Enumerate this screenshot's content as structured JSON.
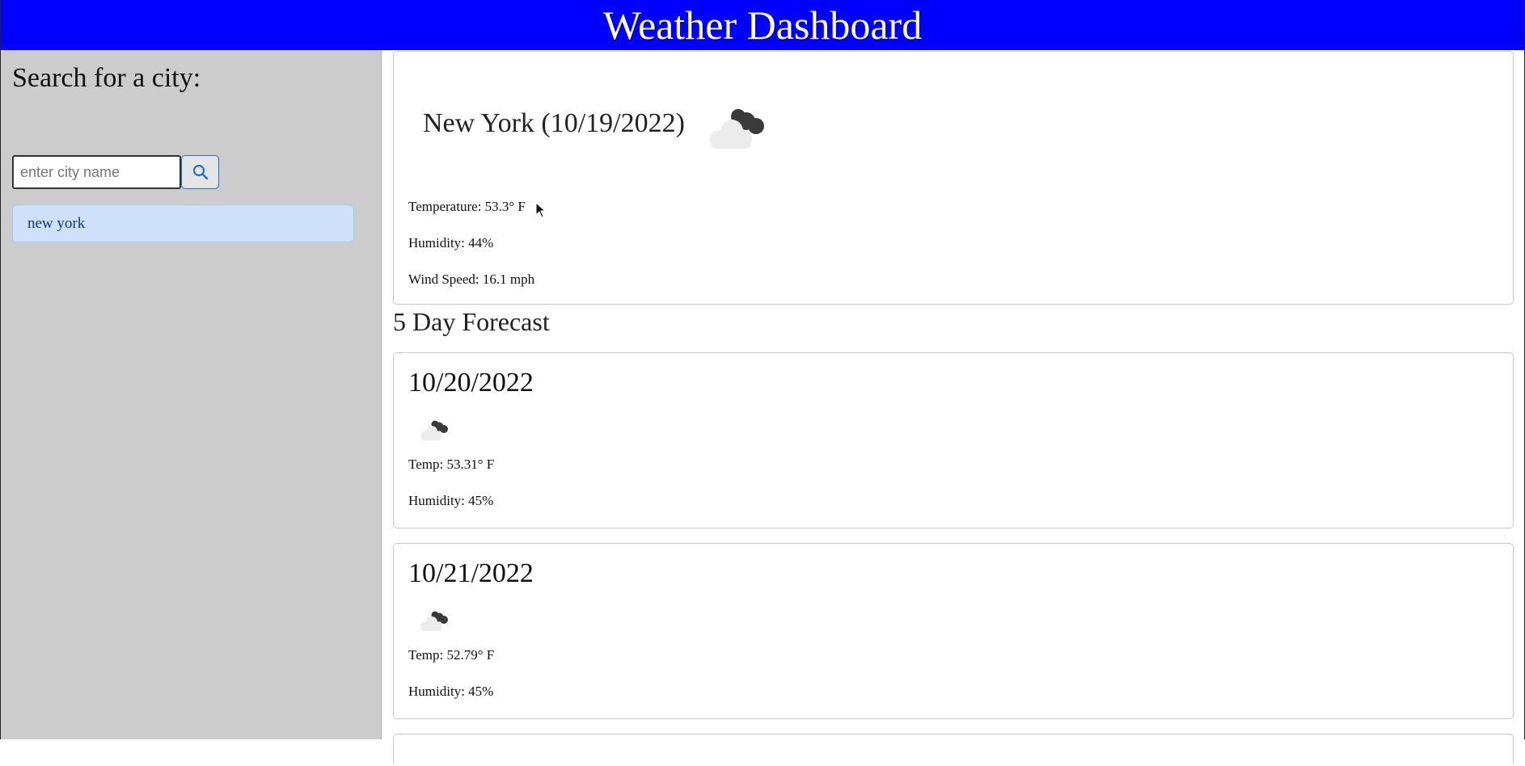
{
  "header": {
    "title": "Weather Dashboard"
  },
  "colors": {
    "header_bg": "#0000ff",
    "sidebar_bg": "#cccccc",
    "history_bg": "#cfe0fa",
    "button_border": "#1e6fd9"
  },
  "sidebar": {
    "heading": "Search for a city:",
    "search": {
      "placeholder": "enter city name",
      "value": ""
    },
    "search_button_icon": "search-icon",
    "history": [
      "new york"
    ]
  },
  "current": {
    "title": "New York (10/19/2022)",
    "icon": "cloud-icon",
    "temperature": "Temperature: 53.3° F",
    "humidity": "Humidity: 44%",
    "wind": "Wind Speed: 16.1 mph"
  },
  "forecast": {
    "heading": "5 Day Forecast",
    "days": [
      {
        "date": "10/20/2022",
        "icon": "cloud-icon",
        "temp": "Temp: 53.31° F",
        "humidity": "Humidity: 45%"
      },
      {
        "date": "10/21/2022",
        "icon": "cloud-icon",
        "temp": "Temp: 52.79° F",
        "humidity": "Humidity: 45%"
      }
    ]
  }
}
